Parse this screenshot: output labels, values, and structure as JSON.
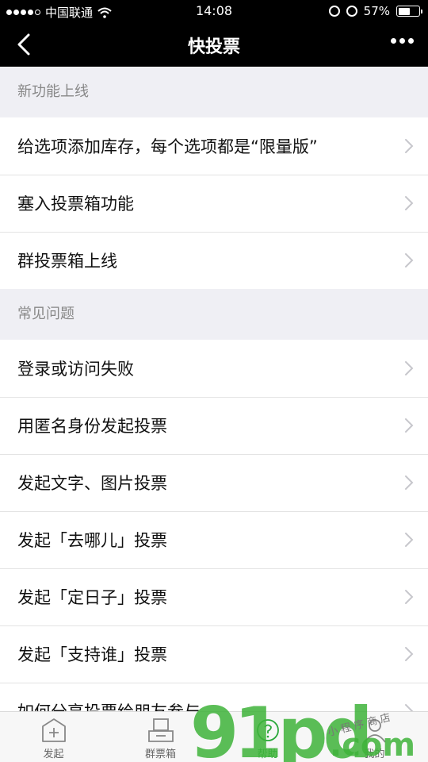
{
  "status_bar": {
    "carrier": "中国联通",
    "time": "14:08",
    "battery_percent": "57%",
    "battery_level": 0.57,
    "signal_strength": 4
  },
  "nav": {
    "title": "快投票",
    "back_icon": "chevron-left-icon",
    "more_icon": "more-dots-icon"
  },
  "sections": [
    {
      "header": "新功能上线",
      "items": [
        "给选项添加库存，每个选项都是“限量版”",
        "塞入投票箱功能",
        "群投票箱上线"
      ]
    },
    {
      "header": "常见问题",
      "items": [
        "登录或访问失败",
        "用匿名身份发起投票",
        "发起文字、图片投票",
        "发起「去哪儿」投票",
        "发起「定日子」投票",
        "发起「支持谁」投票",
        "如何分享投票给朋友参与"
      ]
    }
  ],
  "tabs": [
    {
      "label": "发起",
      "icon": "plus-box-icon"
    },
    {
      "label": "群票箱",
      "icon": "ballot-box-icon"
    },
    {
      "label": "帮助",
      "icon": "help-icon",
      "active": true
    },
    {
      "label": "我的",
      "icon": "person-icon"
    }
  ],
  "watermark": {
    "main": "91pd",
    "suffix": ".com",
    "handwriting": "小程序商店"
  },
  "colors": {
    "nav_background": "#000000",
    "page_background": "#efeff4",
    "active_tab": "#2aa83a",
    "watermark_green": "#3fb33a"
  }
}
